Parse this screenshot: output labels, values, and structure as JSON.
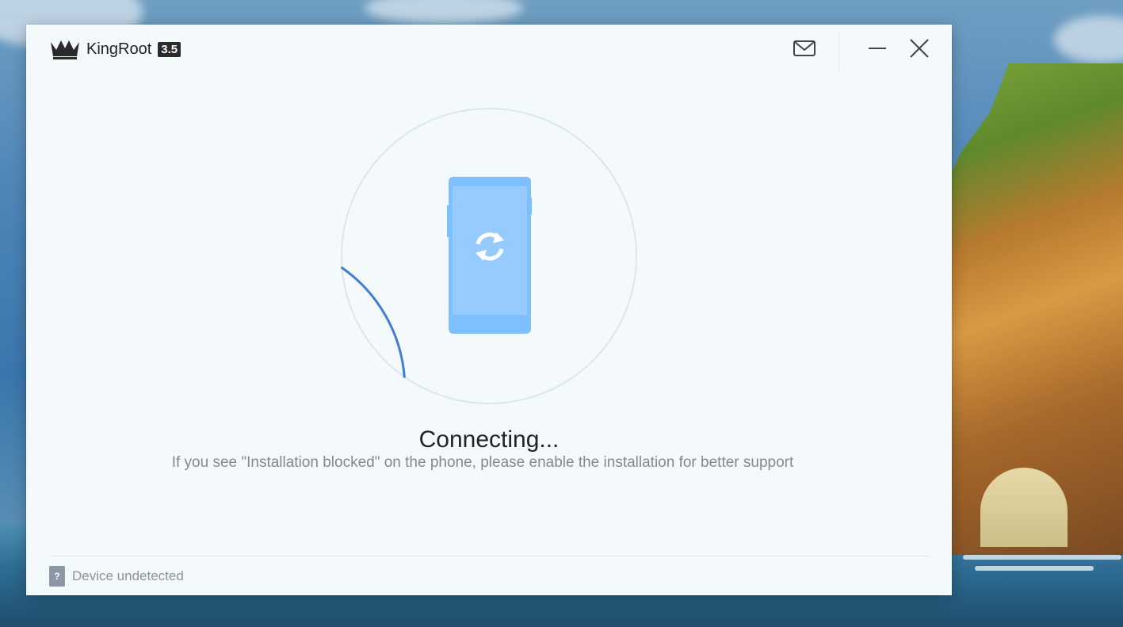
{
  "app": {
    "name": "KingRoot",
    "version": "3.5"
  },
  "titlebar": {
    "icons": [
      "crown-icon",
      "mail-icon",
      "minimize-icon",
      "close-icon"
    ]
  },
  "main": {
    "status_title": "Connecting...",
    "status_hint": "If you see \"Installation blocked\" on the phone, please enable the installation for better support",
    "progress": 0.14,
    "icons": [
      "phone-icon",
      "sync-icon"
    ]
  },
  "footer": {
    "device_badge": "?",
    "device_status": "Device undetected"
  },
  "colors": {
    "accent": "#3f7fd6",
    "phone_body": "#7ebfff",
    "phone_screen": "#97caff",
    "window_bg": "#f4f9fc"
  }
}
